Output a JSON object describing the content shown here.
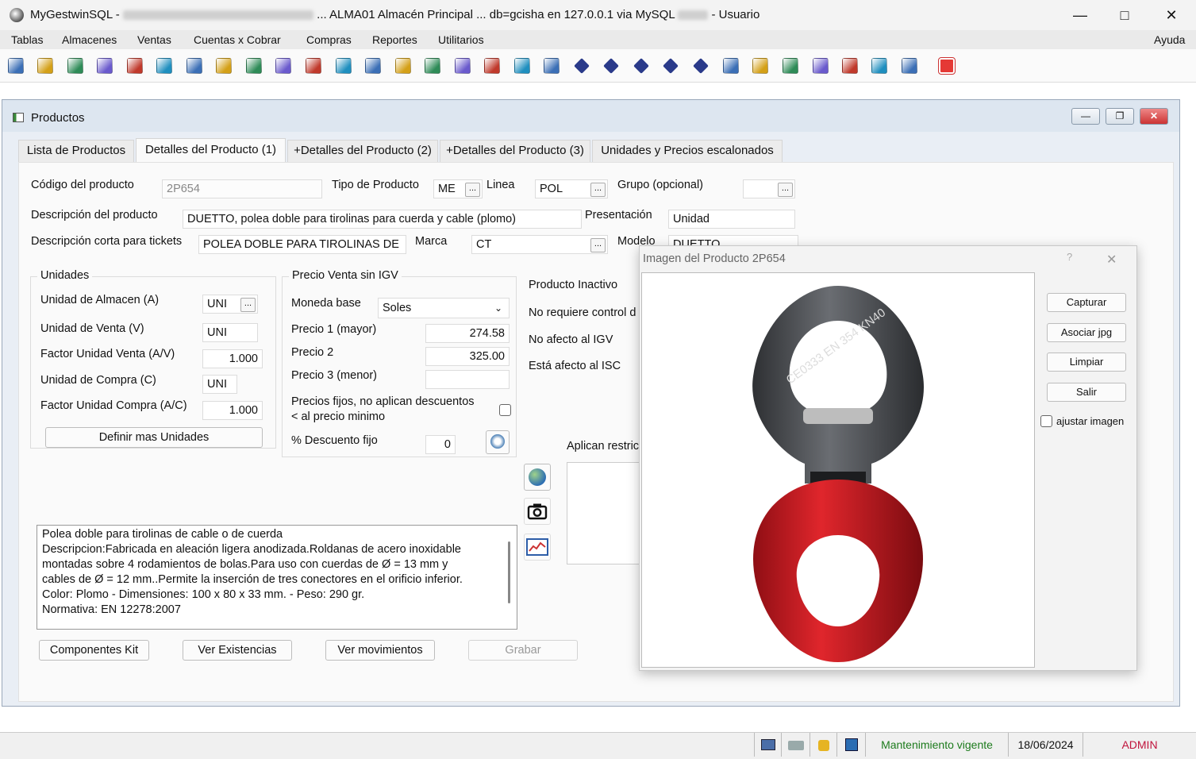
{
  "window": {
    "app_name": "MyGestwinSQL -",
    "title_rest": "... ALMA01   Almacén Principal ... db=gcisha en 127.0.0.1 via MySQL",
    "title_end": "- Usuario"
  },
  "menu": {
    "items": [
      "Tablas",
      "Almacenes",
      "Ventas",
      "Cuentas x Cobrar",
      "Compras",
      "Reportes",
      "Utilitarios"
    ],
    "help": "Ayuda"
  },
  "toolbar": {
    "icons": [
      "toolbar-users-icon",
      "toolbar-people-icon",
      "toolbar-db-icon",
      "toolbar-form-icon",
      "toolbar-box-icon",
      "toolbar-copy-icon",
      "toolbar-edit-icon",
      "toolbar-window-icon",
      "toolbar-calc-icon",
      "toolbar-card-icon",
      "toolbar-dollar-icon",
      "toolbar-money-icon",
      "toolbar-refresh-icon",
      "toolbar-stack-icon",
      "toolbar-note-icon",
      "toolbar-boxes-icon",
      "toolbar-barchart-icon",
      "toolbar-linechart-icon",
      "toolbar-print-icon",
      "toolbar-diamond-1-icon",
      "toolbar-diamond-2-icon",
      "toolbar-diamond-3-icon",
      "toolbar-diamond-4-icon",
      "toolbar-diamond-5-icon",
      "toolbar-save-icon",
      "toolbar-save-all-icon",
      "toolbar-folder-icon",
      "toolbar-folder2-icon",
      "toolbar-report-icon",
      "toolbar-group-icon",
      "toolbar-lock-icon",
      "toolbar-exit-icon"
    ]
  },
  "products_window": {
    "title": "Productos",
    "tabs": [
      "Lista de Productos",
      "Detalles del Producto (1)",
      "+Detalles del Producto (2)",
      "+Detalles del Producto (3)",
      "Unidades y Precios escalonados"
    ],
    "labels": {
      "codigo": "Código del producto",
      "tipo": "Tipo de Producto",
      "linea": "Linea",
      "grupo": "Grupo  (opcional)",
      "descripcion": "Descripción del producto",
      "presentacion": "Presentación",
      "desc_corta": "Descripción corta para tickets",
      "marca": "Marca",
      "modelo": "Modelo"
    },
    "values": {
      "codigo": "2P654",
      "tipo": "ME",
      "linea": "POL",
      "grupo": "",
      "descripcion": "DUETTO, polea doble para tirolinas para cuerda y cable (plomo)",
      "presentacion": "Unidad",
      "desc_corta": "POLEA DOBLE PARA TIROLINAS DE",
      "marca": "CT",
      "modelo": "DUETTO",
      "dots": "..."
    },
    "unidades": {
      "title": "Unidades",
      "rows": [
        {
          "label": "Unidad de Almacen (A)",
          "value": "UNI"
        },
        {
          "label": "Unidad de Venta (V)",
          "value": "UNI"
        },
        {
          "label": "Factor Unidad Venta (A/V)",
          "value": "1.000"
        },
        {
          "label": "Unidad de Compra (C)",
          "value": "UNI"
        },
        {
          "label": "Factor Unidad Compra (A/C)",
          "value": "1.000"
        }
      ],
      "define_button": "Definir mas Unidades"
    },
    "precio": {
      "title": "Precio Venta  sin IGV",
      "moneda_label": "Moneda base",
      "moneda_value": "Soles",
      "precio1_label": "Precio 1 (mayor)",
      "precio1_value": "274.58",
      "precio2_label": "Precio 2",
      "precio2_value": "325.00",
      "precio3_label": "Precio 3 (menor)",
      "precio3_value": "",
      "fijos_label_1": "Precios fijos, no aplican descuentos",
      "fijos_label_2": "< al precio minimo",
      "descuento_label": "% Descuento fijo",
      "descuento_value": "0"
    },
    "flags": {
      "inactivo": "Producto Inactivo",
      "no_control": "No requiere control d",
      "no_igv": "No afecto al IGV",
      "isc": "Está afecto al ISC",
      "restric": "Aplican restric"
    },
    "description_lines": [
      "Polea doble para tirolinas de cable o de cuerda",
      "Descripcion:Fabricada en aleación ligera anodizada.Roldanas de acero inoxidable",
      "montadas sobre 4 rodamientos de bolas.Para uso con cuerdas de Ø = 13 mm y",
      "cables de Ø = 12 mm..Permite la inserción de tres conectores en el orificio inferior.",
      "Color: Plomo  -  Dimensiones: 100 x 80 x 33 mm.  -  Peso: 290 gr.",
      "Normativa: EN 12278:2007"
    ],
    "bottom_buttons": [
      "Componentes Kit",
      "Ver Existencias",
      "Ver movimientos",
      "Grabar"
    ]
  },
  "image_dialog": {
    "title": "Imagen del Producto 2P654",
    "help": "?",
    "close": "✕",
    "buttons": [
      "Capturar",
      "Asociar jpg",
      "Limpiar",
      "Salir"
    ],
    "checkbox_label": "ajustar imagen",
    "engraving": "CE0333 EN 354 KN40"
  },
  "status": {
    "mantenimiento": "Mantenimiento vigente",
    "date": "18/06/2024",
    "user": "ADMIN"
  },
  "colors": {
    "status_green": "#1d7b1d",
    "status_red": "#c0143c",
    "pulley_red": "#c8141e",
    "pulley_gray": "#4a4c50"
  }
}
